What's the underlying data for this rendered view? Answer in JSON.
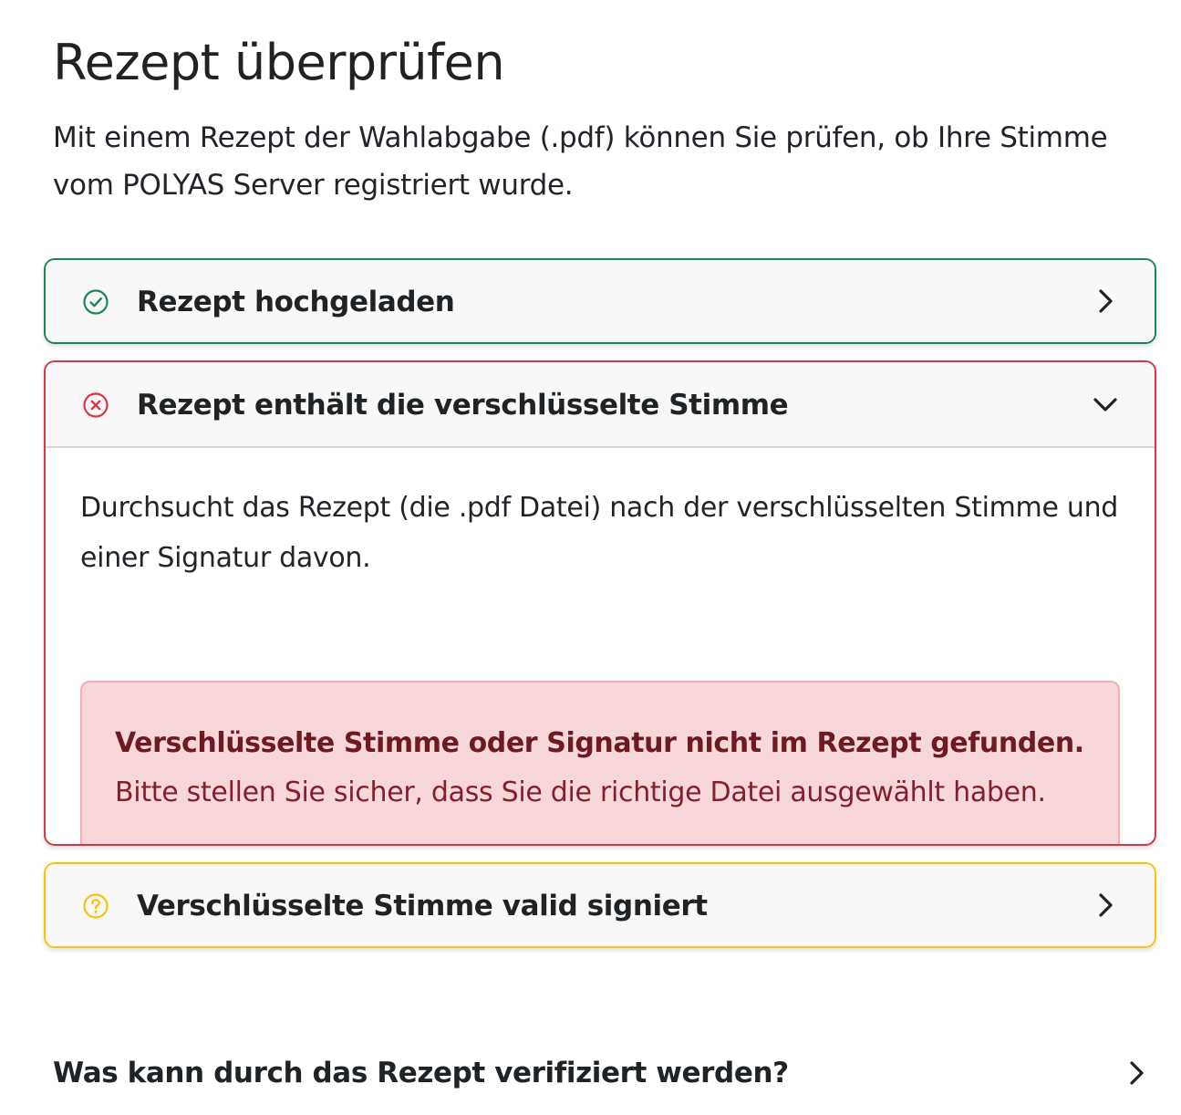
{
  "page": {
    "title": "Rezept überprüfen",
    "intro": "Mit einem Rezept der Wahlabgabe (.pdf) können Sie prüfen, ob Ihre Stimme vom POLYAS Server registriert wurde."
  },
  "checks": [
    {
      "status": "success",
      "icon": "check-circle-icon",
      "color": "#198754",
      "title": "Rezept hochgeladen",
      "expanded": false
    },
    {
      "status": "error",
      "icon": "x-circle-icon",
      "color": "#dc3545",
      "title": "Rezept enthält die verschlüsselte Stimme",
      "expanded": true,
      "description": "Durchsucht das Rezept (die .pdf Datei) nach der verschlüsselten Stimme und einer Signatur davon.",
      "alert": {
        "title": "Verschlüsselte Stimme oder Signatur nicht im Rezept gefunden.",
        "text": "Bitte stellen Sie sicher, dass Sie die richtige Datei ausgewählt haben."
      }
    },
    {
      "status": "pending",
      "icon": "question-circle-icon",
      "color": "#ffc107",
      "title": "Verschlüsselte Stimme valid signiert",
      "expanded": false
    }
  ],
  "faq": {
    "question": "Was kann durch das Rezept verifiziert werden?",
    "expanded": false
  }
}
